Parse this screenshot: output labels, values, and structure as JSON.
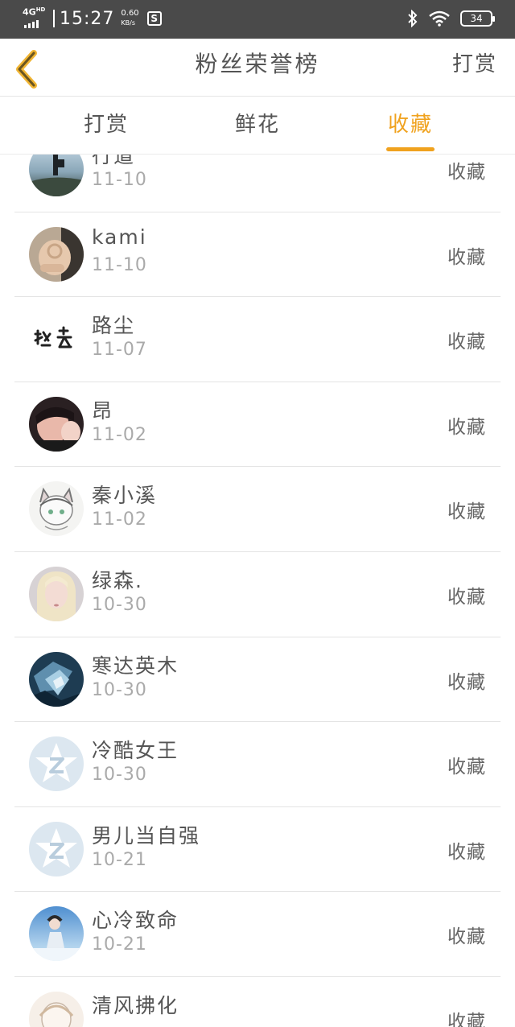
{
  "status_bar": {
    "network": "4G",
    "network_hd": "HD",
    "time": "15:27",
    "speed_value": "0.60",
    "speed_unit": "KB/s",
    "battery": "34"
  },
  "header": {
    "title": "粉丝荣誉榜",
    "right_action": "打赏"
  },
  "tabs": [
    {
      "label": "打赏",
      "active": false
    },
    {
      "label": "鲜花",
      "active": false
    },
    {
      "label": "收藏",
      "active": true
    }
  ],
  "accent_color": "#f0a21e",
  "list": [
    {
      "name": "行道",
      "date": "11-10",
      "action": "收藏",
      "avatar": "landscape-person"
    },
    {
      "name": "kami",
      "date": "11-10",
      "action": "收藏",
      "avatar": "hand-photo"
    },
    {
      "name": "路尘",
      "date": "11-07",
      "action": "收藏",
      "avatar": "calligraphy"
    },
    {
      "name": "昂",
      "date": "11-02",
      "action": "收藏",
      "avatar": "face-photo"
    },
    {
      "name": "秦小溪",
      "date": "11-02",
      "action": "收藏",
      "avatar": "anime-cat"
    },
    {
      "name": "绿森.",
      "date": "10-30",
      "action": "收藏",
      "avatar": "blonde-girl"
    },
    {
      "name": "寒达英木",
      "date": "10-30",
      "action": "收藏",
      "avatar": "blue-abstract"
    },
    {
      "name": "冷酷女王",
      "date": "10-30",
      "action": "收藏",
      "avatar": "qzone-default"
    },
    {
      "name": "男儿当自强",
      "date": "10-21",
      "action": "收藏",
      "avatar": "qzone-default"
    },
    {
      "name": "心冷致命",
      "date": "10-21",
      "action": "收藏",
      "avatar": "stage-singer"
    },
    {
      "name": "清风拂化",
      "date": "",
      "action": "收藏",
      "avatar": "sketch"
    }
  ]
}
